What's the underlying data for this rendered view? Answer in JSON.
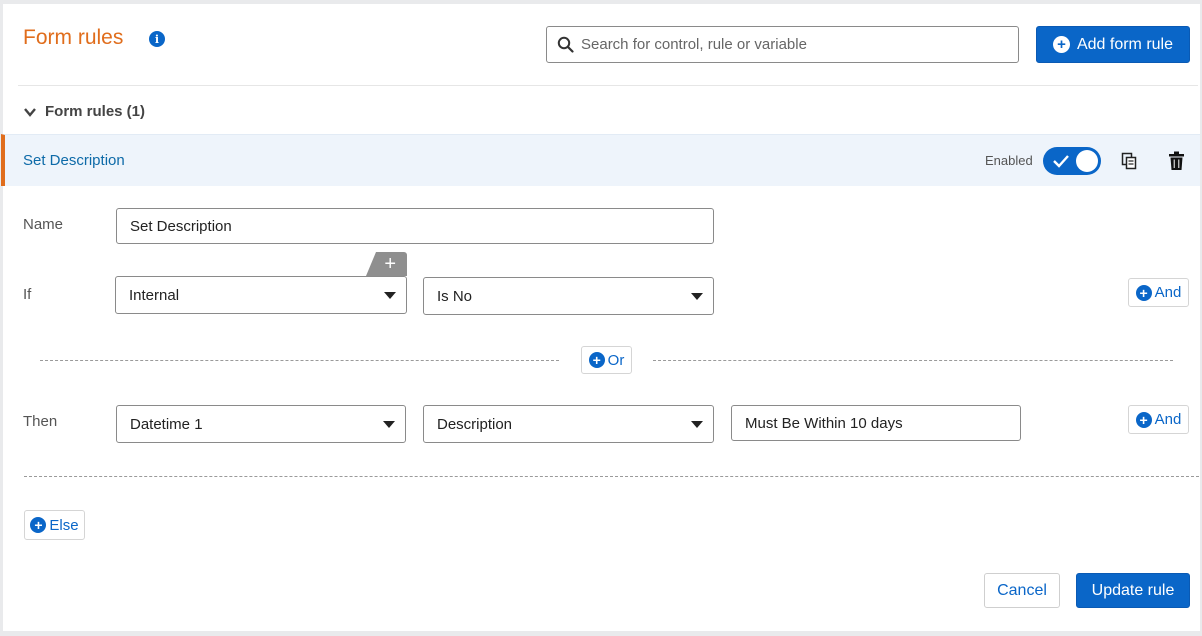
{
  "header": {
    "title": "Form rules",
    "info_icon": "info-icon",
    "search": {
      "placeholder": "Search for control, rule or variable",
      "value": ""
    },
    "add_button": {
      "label": "Add form rule",
      "icon": "plus-circle-icon"
    }
  },
  "section": {
    "label": "Form rules (1)",
    "expanded": true
  },
  "rule": {
    "title": "Set Description",
    "enabled_label": "Enabled",
    "enabled": true,
    "name_label": "Name",
    "name_value": "Set Description",
    "if_label": "If",
    "condition": {
      "control": "Internal",
      "operator": "Is No"
    },
    "then_label": "Then",
    "action": {
      "control": "Datetime 1",
      "property": "Description",
      "value": "Must Be Within 10 days"
    },
    "and_label": "And",
    "or_label": "Or",
    "else_label": "Else",
    "cancel_label": "Cancel",
    "update_label": "Update rule"
  },
  "colors": {
    "accent_orange": "#e06d1c",
    "primary_blue": "#0a66c8",
    "rule_bar_bg": "#eef4fb"
  }
}
